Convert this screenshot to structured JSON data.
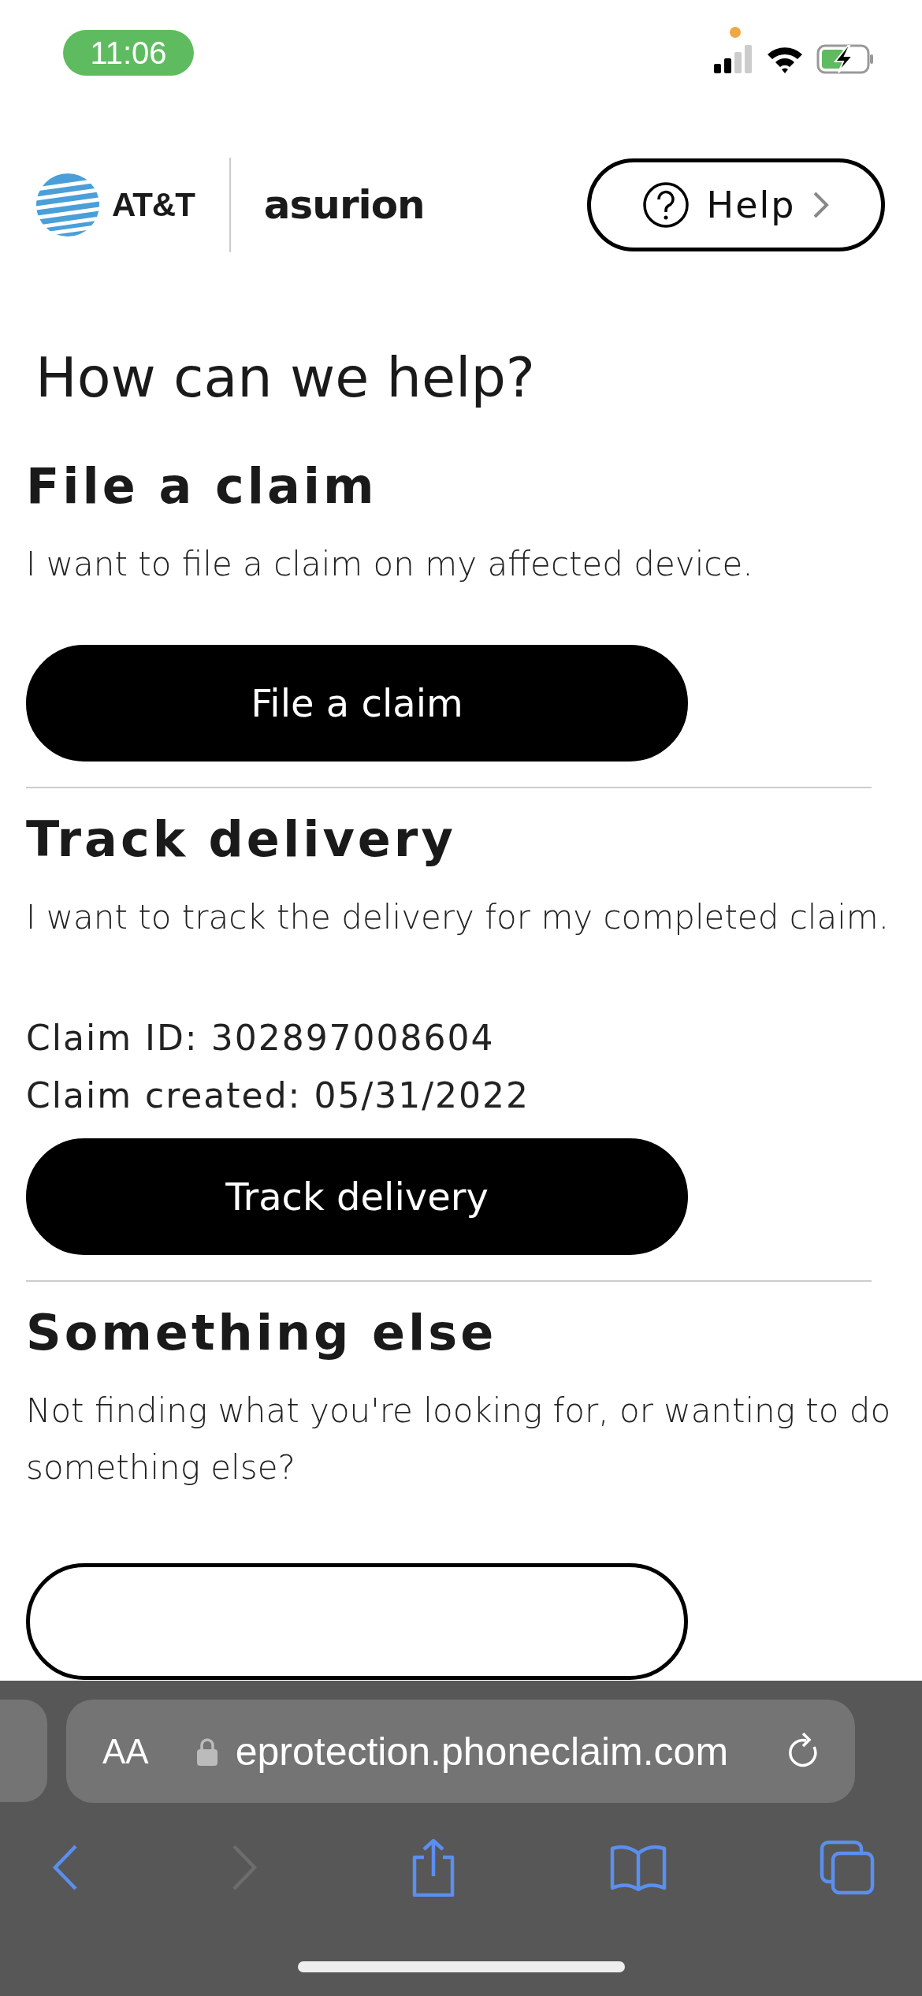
{
  "status_bar": {
    "time": "11:06"
  },
  "header": {
    "brand_left": "AT&T",
    "brand_right": "asurion",
    "help_button": "Help"
  },
  "title": "How can we help?",
  "sections": [
    {
      "kind": "filled",
      "heading": "File a claim",
      "text": "I want to file a claim on my affected device.",
      "button": "File a claim"
    },
    {
      "kind": "filled",
      "heading": "Track delivery",
      "text": "I want to track the delivery for my completed claim.",
      "details": [
        "Claim ID: 302897008604",
        "Claim created: 05/31/2022"
      ],
      "button": "Track delivery"
    },
    {
      "kind": "outline",
      "heading": "Something else",
      "text": "Not finding what you're looking for, or wanting to do something else?"
    }
  ],
  "browser": {
    "text_size": "AA",
    "url": "eprotection.phoneclaim.com"
  }
}
